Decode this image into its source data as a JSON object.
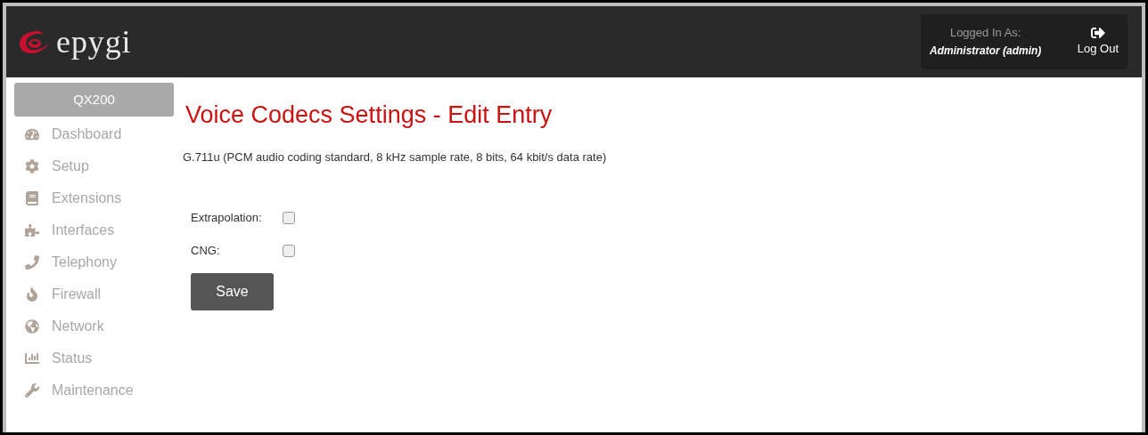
{
  "header": {
    "logo_text": "epygi",
    "logged_in_label": "Logged In As:",
    "user": "Administrator (admin)",
    "logout": "Log Out"
  },
  "sidebar": {
    "device": "QX200",
    "items": [
      {
        "label": "Dashboard",
        "selected": false
      },
      {
        "label": "Setup",
        "selected": false
      },
      {
        "label": "Extensions",
        "selected": false
      },
      {
        "label": "Interfaces",
        "selected": false
      },
      {
        "label": "Telephony",
        "selected": false
      },
      {
        "label": "Firewall",
        "selected": false
      },
      {
        "label": "Network",
        "selected": false
      },
      {
        "label": "Status",
        "selected": false
      },
      {
        "label": "Maintenance",
        "selected": false
      }
    ]
  },
  "page": {
    "title": "Voice Codecs Settings - Edit Entry",
    "description": "G.711u (PCM audio coding standard, 8 kHz sample rate, 8 bits, 64 kbit/s data rate)",
    "fields": [
      {
        "label": "Extrapolation:",
        "checked": false
      },
      {
        "label": "CNG:",
        "checked": false
      }
    ],
    "save": "Save"
  }
}
